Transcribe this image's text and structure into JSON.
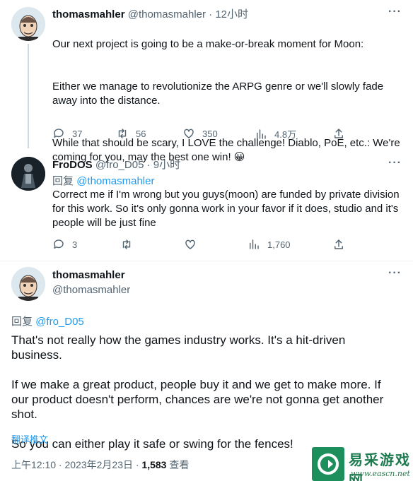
{
  "tweets": [
    {
      "name": "thomasmahler",
      "handle": "@thomasmahler",
      "separator": "·",
      "time": "12小时",
      "paragraphs": [
        "Our next project is going to be a make-or-break moment for Moon:",
        "Either we manage to revolutionize the ARPG genre or we'll slowly fade away into the distance.",
        "While that should be scary, I LOVE the challenge! Diablo, PoE, etc.: We're coming for you, may the best one win! 😀"
      ],
      "replies": "37",
      "retweets": "56",
      "likes": "350",
      "views": "4.8万"
    },
    {
      "name": "FroDOS",
      "handle": "@fro_D05",
      "separator": "·",
      "time": "9小时",
      "reply_prefix": "回复",
      "reply_to": "@thomasmahler",
      "text": "Correct me if I'm wrong but you guys(moon) are funded by private division for this work. So it's only gonna work in your favor if it does, studio and it's people will be just fine",
      "replies": "3",
      "views": "1,760"
    }
  ],
  "main_tweet": {
    "name": "thomasmahler",
    "handle": "@thomasmahler",
    "reply_prefix": "回复",
    "reply_to": "@fro_D05",
    "paragraphs": [
      "That's not really how the games industry works. It's a hit-driven business.",
      "If we make a great product, people buy it and we get to make more. If our product doesn't perform, chances are we're not gonna get another shot.",
      "So you can either play it safe or swing for the fences!"
    ],
    "translate": "翻译推文",
    "timestamp": "上午12:10 · 2023年2月23日 · ",
    "view_count": "1,583",
    "view_label": " 查看"
  },
  "watermark": {
    "title": "易采游戏网",
    "url": "www.eascn.net"
  },
  "colors": {
    "link": "#1d9bf0",
    "muted": "#536471",
    "divider": "#eff3f4",
    "brand_green": "#1d8f5c"
  }
}
